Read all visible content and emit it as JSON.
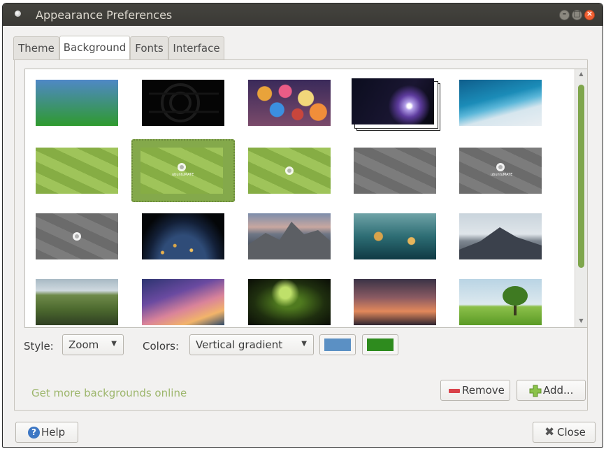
{
  "window": {
    "title": "Appearance Preferences",
    "controls": [
      "minimize-icon",
      "maximize-icon",
      "close-icon"
    ]
  },
  "tabs": [
    {
      "label": "Theme",
      "active": false
    },
    {
      "label": "Background",
      "active": true
    },
    {
      "label": "Fonts",
      "active": false
    },
    {
      "label": "Interface",
      "active": false
    }
  ],
  "gallery": {
    "thumbnails": [
      {
        "name": "blue-green-gradient"
      },
      {
        "name": "dark-logo-pattern"
      },
      {
        "name": "bokeh-lights"
      },
      {
        "name": "comet-in-space",
        "stacked": true
      },
      {
        "name": "ocean-waves-aerial"
      },
      {
        "name": "green-pattern"
      },
      {
        "name": "green-pattern-ubuntu-mate",
        "selected": true,
        "text": "ubuntuMATE"
      },
      {
        "name": "green-pattern-logo"
      },
      {
        "name": "grey-pattern"
      },
      {
        "name": "grey-pattern-ubuntu-mate",
        "text": "ubuntuMATE"
      },
      {
        "name": "grey-pattern-logo"
      },
      {
        "name": "earth-at-night"
      },
      {
        "name": "mountain-valley-sunset"
      },
      {
        "name": "rain-drops-window"
      },
      {
        "name": "misty-mountain"
      },
      {
        "name": "green-cliffs"
      },
      {
        "name": "milky-way-horizon"
      },
      {
        "name": "abstract-green-light"
      },
      {
        "name": "dusk-mountain-lake"
      },
      {
        "name": "lone-tree-meadow"
      }
    ]
  },
  "options": {
    "style_label": "Style:",
    "style_value": "Zoom",
    "colors_label": "Colors:",
    "colors_value": "Vertical gradient",
    "primary_color": "#5b90c4",
    "secondary_color": "#2e8b1e"
  },
  "actions": {
    "more_link": "Get more backgrounds online",
    "remove_label": "Remove",
    "add_label": "Add..."
  },
  "footer": {
    "help_label": "Help",
    "close_label": "Close"
  },
  "colors": {
    "accent": "#84a94b",
    "link": "#9db66c"
  }
}
